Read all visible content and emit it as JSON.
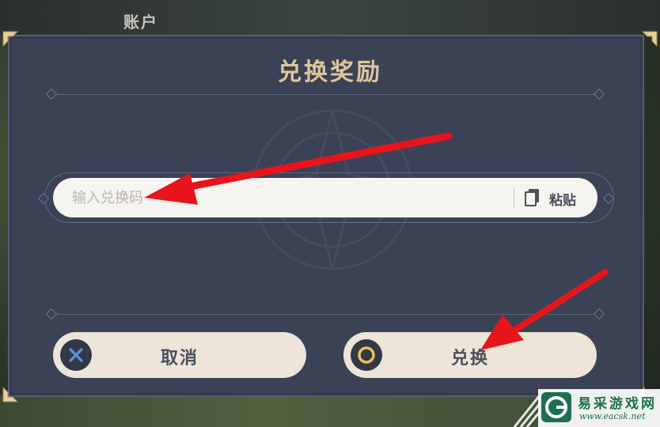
{
  "background": {
    "account_label": "账户"
  },
  "dialog": {
    "title": "兑换奖励",
    "input": {
      "placeholder": "输入兑换码",
      "value": "",
      "paste_label": "粘贴"
    },
    "cancel_label": "取消",
    "confirm_label": "兑换"
  },
  "icons": {
    "paste": "clipboard-icon",
    "cancel": "close-icon",
    "confirm": "circle-icon"
  },
  "colors": {
    "dialog_bg": "#3b4255",
    "title": "#ddc69c",
    "button_bg": "#ece5d8",
    "arrow": "#e8141c",
    "cancel_icon": "#5a8fd6",
    "confirm_icon": "#e8c15a"
  },
  "watermark": {
    "title": "易采游戏网",
    "url": "www.eacsk.net"
  }
}
